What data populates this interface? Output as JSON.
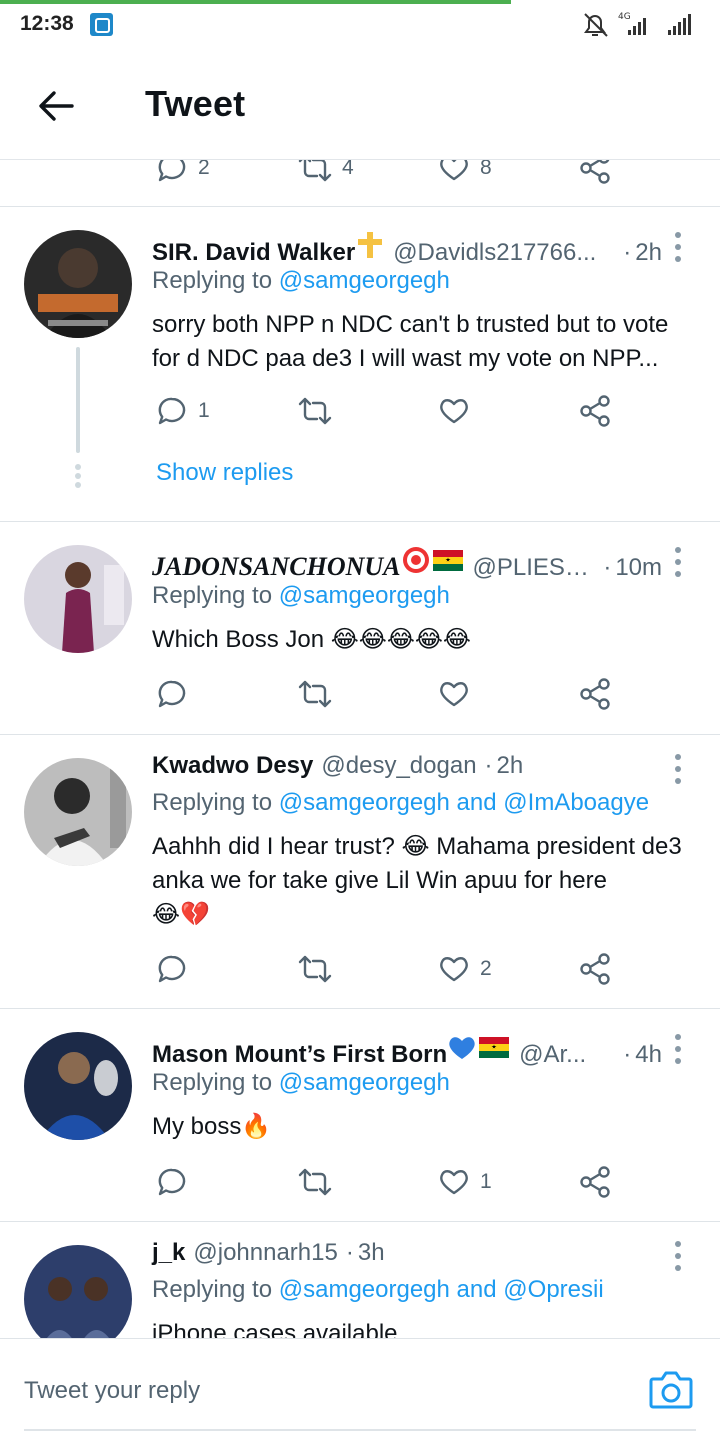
{
  "status_bar": {
    "time": "12:38",
    "network_label": "4G",
    "icons": [
      "mi-app-badge",
      "bell-muted-icon",
      "signal-4g-icon",
      "signal-icon"
    ]
  },
  "app_bar": {
    "title": "Tweet",
    "back_icon": "arrow-left-icon"
  },
  "top_partial_actions": {
    "reply_count": "2",
    "retweet_count": "4",
    "like_count": "8"
  },
  "tweets": [
    {
      "name": "SIR. David Walker",
      "name_emoji": "✝ cross",
      "handle": "@Davidls217766...",
      "dot": "·",
      "time": "2h",
      "replying_prefix": "Replying to ",
      "replying_to": "@samgeorgegh",
      "replying_and": "",
      "replying_to_2": "",
      "text": "sorry both NPP n NDC can't b trusted but to vote for d NDC paa de3 I will wast my vote on NPP...",
      "reply_count": "1",
      "retweet_count": "",
      "like_count": "",
      "show_replies": "Show replies"
    },
    {
      "name": "JADONSANCHONUA",
      "name_emoji": "🎯🇬🇭",
      "handle": "@PLIESS...",
      "dot": "·",
      "time": "10m",
      "replying_prefix": "Replying to ",
      "replying_to": "@samgeorgegh",
      "replying_and": "",
      "replying_to_2": "",
      "text": "Which Boss Jon ",
      "text_emoji": "😂😂😂😂😂",
      "reply_count": "",
      "retweet_count": "",
      "like_count": ""
    },
    {
      "name": "Kwadwo Desy",
      "handle": "@desy_dogan",
      "dot": "·",
      "time": "2h",
      "replying_prefix": "Replying to ",
      "replying_to": "@samgeorgegh",
      "replying_and": " and ",
      "replying_to_2": "@ImAboagye",
      "text_part1": "Aahhh did I hear trust? ",
      "text_emoji1": "😂",
      "text_part2": " Mahama president de3 anka we for take give Lil Win apuu for here",
      "text_emoji2": "😂💔",
      "reply_count": "",
      "retweet_count": "",
      "like_count": "2"
    },
    {
      "name": "Mason Mount’s First Born",
      "name_emoji": "💙🇬🇭",
      "handle": "@Ar...",
      "dot": "·",
      "time": "4h",
      "replying_prefix": "Replying to ",
      "replying_to": "@samgeorgegh",
      "replying_and": "",
      "replying_to_2": "",
      "text": "My boss",
      "text_emoji": "🔥",
      "reply_count": "",
      "retweet_count": "",
      "like_count": "1"
    },
    {
      "name": "j_k",
      "handle": "@johnnarh15",
      "dot": "·",
      "time": "3h",
      "replying_prefix": "Replying to ",
      "replying_to": "@samgeorgegh",
      "replying_and": " and ",
      "replying_to_2": "@Opresii",
      "text": "iPhone cases available"
    }
  ],
  "reply_bar": {
    "placeholder": "Tweet your reply",
    "camera_icon": "camera-icon"
  },
  "colors": {
    "link": "#1d9bf0",
    "secondary_text": "#536471",
    "progress": "#4caf50"
  }
}
